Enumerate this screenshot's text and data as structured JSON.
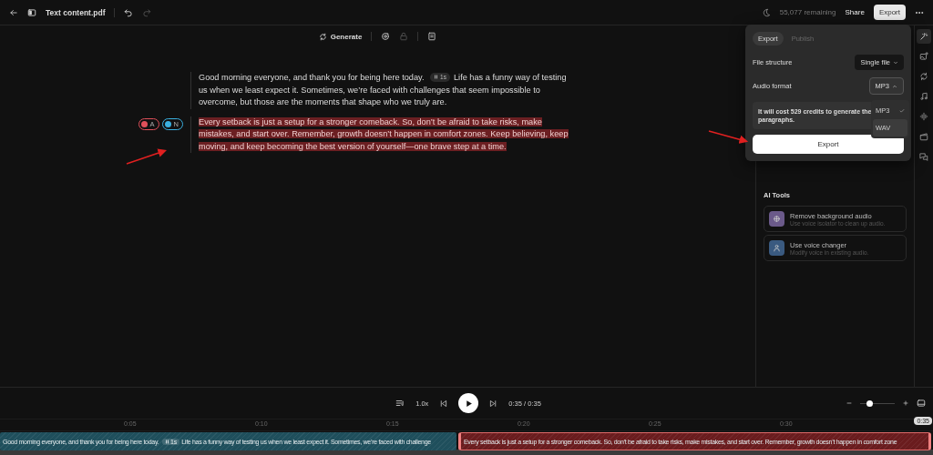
{
  "top_bar": {
    "file_name": "Text content.pdf",
    "credits": "55,077 remaining",
    "share": "Share",
    "export": "Export"
  },
  "toolbar": {
    "generate": "Generate"
  },
  "paragraphs": [
    {
      "highlighted": false,
      "segments": [
        {
          "kind": "text",
          "text": "Good morning everyone, and thank you for being here today."
        },
        {
          "kind": "pause",
          "text": "1s"
        },
        {
          "kind": "text",
          "text": "Life has a funny way of testing us when we least expect it. Sometimes, we’re faced with challenges that seem impossible to overcome, but those are the moments that shape who we truly are."
        }
      ]
    },
    {
      "highlighted": true,
      "voices": [
        {
          "label": "A",
          "color": "#e0505a"
        },
        {
          "label": "N",
          "color": "#3ab0e0"
        }
      ],
      "segments": [
        {
          "kind": "text",
          "text": "Every setback is just a setup for a stronger comeback. So, don’t be afraid to take risks, make mistakes, and start over. Remember, growth doesn’t happen in comfort zones. Keep believing, keep moving, and keep becoming the best version of yourself—one brave step at a time."
        }
      ]
    }
  ],
  "export_popover": {
    "tabs": [
      {
        "label": "Export",
        "selected": true
      },
      {
        "label": "Publish",
        "selected": false
      }
    ],
    "file_structure": {
      "label": "File structure",
      "value": "Single file"
    },
    "audio_format": {
      "label": "Audio format",
      "value": "MP3",
      "expanded": true,
      "options": [
        {
          "label": "MP3",
          "selected": true,
          "highlighted": false
        },
        {
          "label": "WAV",
          "selected": false,
          "highlighted": true
        }
      ]
    },
    "note": "It will cost 529 credits to generate the\nparagraphs.",
    "button": "Export"
  },
  "ai_tools": {
    "title": "AI Tools",
    "items": [
      {
        "title": "Remove background audio",
        "subtitle": "Use voice isolator to clean up audio.",
        "color": "#6b5a8a"
      },
      {
        "title": "Use voice changer",
        "subtitle": "Modify voice in existing audio.",
        "color": "#3a5a80"
      }
    ]
  },
  "rail": [
    {
      "selected": true
    },
    {
      "selected": false
    },
    {
      "selected": false
    },
    {
      "selected": false
    },
    {
      "selected": false
    },
    {
      "selected": false
    },
    {
      "selected": false
    }
  ],
  "player": {
    "speed": "1.0x",
    "time": "0:35 / 0:35",
    "zoom": {
      "level": 0.25
    }
  },
  "timeline": {
    "ticks": [
      "0:05",
      "0:10",
      "0:15",
      "0:20",
      "0:25",
      "0:30"
    ],
    "playhead": "0:35",
    "clips": [
      {
        "color": "#1f4f5c",
        "selected": false,
        "segments": [
          {
            "kind": "text",
            "text": "Good morning everyone, and thank you for being here today."
          },
          {
            "kind": "pause",
            "text": "1s"
          },
          {
            "kind": "text",
            "text": "Life has a funny way of testing us when we least expect it. Sometimes, we’re faced with challenge"
          }
        ]
      },
      {
        "color": "#6a1c1e",
        "selected": true,
        "segments": [
          {
            "kind": "text",
            "text": "Every setback is just a setup for a stronger comeback. So, don’t be afraid to take risks, make mistakes, and start over. Remember, growth doesn’t happen in comfort zone"
          }
        ]
      }
    ]
  }
}
